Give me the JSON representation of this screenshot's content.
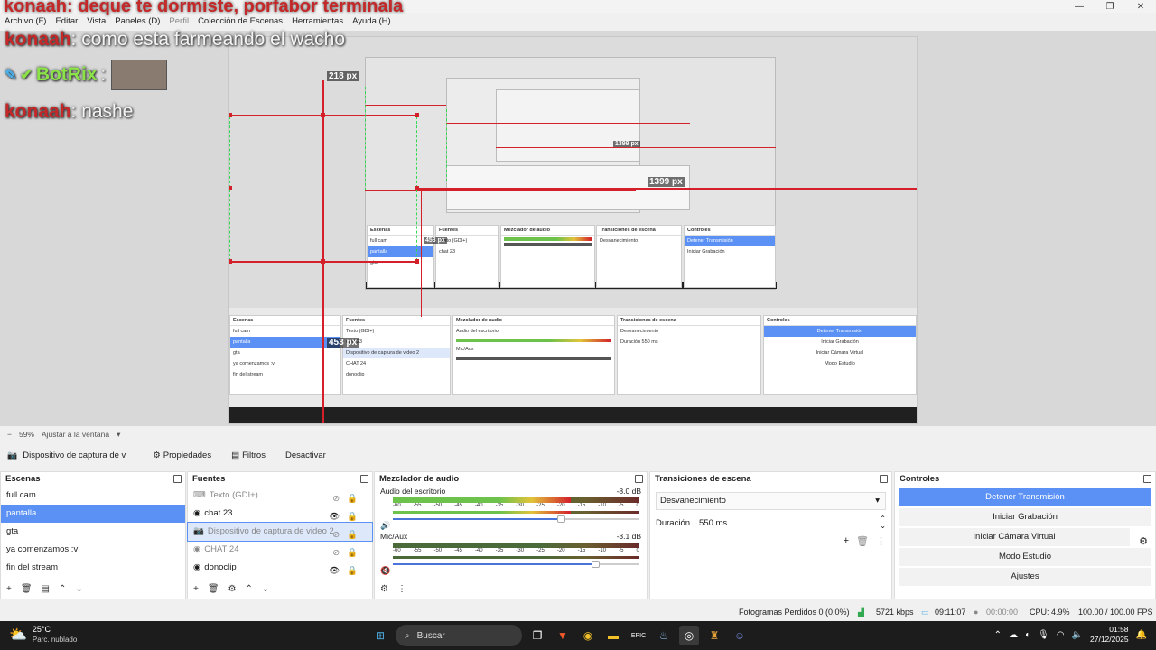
{
  "window": {
    "title_overlay": "konaah: deque te dormiste, porfabor terminala",
    "controls": [
      "—",
      "❐",
      "✕"
    ]
  },
  "menu": [
    "Archivo (F)",
    "Editar",
    "Vista",
    "Paneles (D)",
    "Perfil",
    "Colección de Escenas",
    "Herramientas",
    "Ayuda (H)"
  ],
  "chat": {
    "lines": [
      {
        "user": "konaah",
        "msg": ": como esta farmeando el wacho"
      },
      {
        "user": "BotRix",
        "msg": ":"
      },
      {
        "user": "konaah",
        "msg": ": nashe"
      }
    ],
    "nested_ghost": "porfabor terminala"
  },
  "preview": {
    "px_labels": [
      "218 px",
      "1399 px",
      "453 px",
      "1399 px",
      "453 px"
    ],
    "zoom": "59%",
    "fit_label": "Ajustar a la ventana"
  },
  "source_toolbar": {
    "source_name": "Dispositivo de captura de v",
    "properties": "Propiedades",
    "filters": "Filtros",
    "deactivate": "Desactivar"
  },
  "scenes": {
    "title": "Escenas",
    "items": [
      "full cam",
      "pantalla",
      "gta",
      "ya comenzamos :v",
      "fin del stream"
    ],
    "selected_index": 1
  },
  "sources": {
    "title": "Fuentes",
    "items": [
      {
        "name": "Texto (GDI+)",
        "icon": "text-icon",
        "visible": false
      },
      {
        "name": "chat 23",
        "icon": "browser-icon",
        "visible": true
      },
      {
        "name": "Dispositivo de captura de video 2",
        "icon": "camera-icon",
        "visible": false
      },
      {
        "name": "CHAT 24",
        "icon": "browser-icon",
        "visible": false
      },
      {
        "name": "donoclip",
        "icon": "browser-icon",
        "visible": true
      }
    ],
    "selected_index": 2
  },
  "mixer": {
    "title": "Mezclador de audio",
    "ticks": [
      "-60",
      "-55",
      "-50",
      "-45",
      "-40",
      "-35",
      "-30",
      "-25",
      "-20",
      "-15",
      "-10",
      "-5",
      "0"
    ],
    "channels": [
      {
        "name": "Audio del escritorio",
        "db": "-8.0 dB",
        "level": 0.72,
        "volume": 0.68,
        "muted": false
      },
      {
        "name": "Mic/Aux",
        "db": "-3.1 dB",
        "level": 0.0,
        "volume": 0.82,
        "muted": true
      }
    ]
  },
  "transitions": {
    "title": "Transiciones de escena",
    "selected": "Desvanecimiento",
    "duration_label": "Duración",
    "duration_value": "550 ms"
  },
  "controls": {
    "title": "Controles",
    "buttons": [
      "Detener Transmisión",
      "Iniciar Grabación",
      "Iniciar Cámara Virtual",
      "Modo Estudio",
      "Ajustes"
    ]
  },
  "status": {
    "dropped": "Fotogramas Perdidos 0 (0.0%)",
    "bitrate": "5721 kbps",
    "stream_time": "09:11:07",
    "rec_time": "00:00:00",
    "cpu": "CPU: 4.9%",
    "fps": "100.00 / 100.00 FPS"
  },
  "taskbar": {
    "temp": "25°C",
    "weather": "Parc. nublado",
    "search": "Buscar",
    "time": "01:58",
    "date": "27/12/2025"
  },
  "colors": {
    "accent": "#5b91f5",
    "guide_red": "#d3202a",
    "guide_green": "#32d850",
    "chat_user": "#c42828",
    "botrix": "#8be34a"
  }
}
